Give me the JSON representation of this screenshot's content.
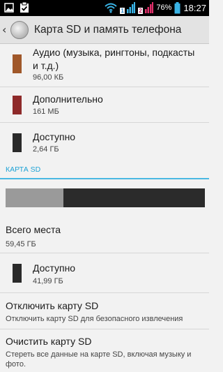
{
  "status_bar": {
    "sim1": "1",
    "sim2": "2",
    "battery": "76%",
    "time": "18:27"
  },
  "action_bar": {
    "title": "Карта SD и память телефона"
  },
  "phone_storage": {
    "items": [
      {
        "title": "Аудио (музыка, рингтоны, подкасты и т.д.)",
        "value": "96,00 КБ",
        "color": "#a0582a"
      },
      {
        "title": "Дополнительно",
        "value": "161 МБ",
        "color": "#8e2a2a"
      },
      {
        "title": "Доступно",
        "value": "2,64 ГБ",
        "color": "#2a2a2a"
      }
    ]
  },
  "sd_card": {
    "section_label": "КАРТА SD",
    "used_fraction": 0.29,
    "total_label": "Всего места",
    "total_value": "59,45 ГБ",
    "available_label": "Доступно",
    "available_value": "41,99 ГБ",
    "available_color": "#2a2a2a",
    "unmount_title": "Отключить карту SD",
    "unmount_desc": "Отключить карту SD для безопасного извлечения",
    "erase_title": "Очистить карту SD",
    "erase_desc": "Стереть все данные на карте SD, включая музыку и фото."
  }
}
